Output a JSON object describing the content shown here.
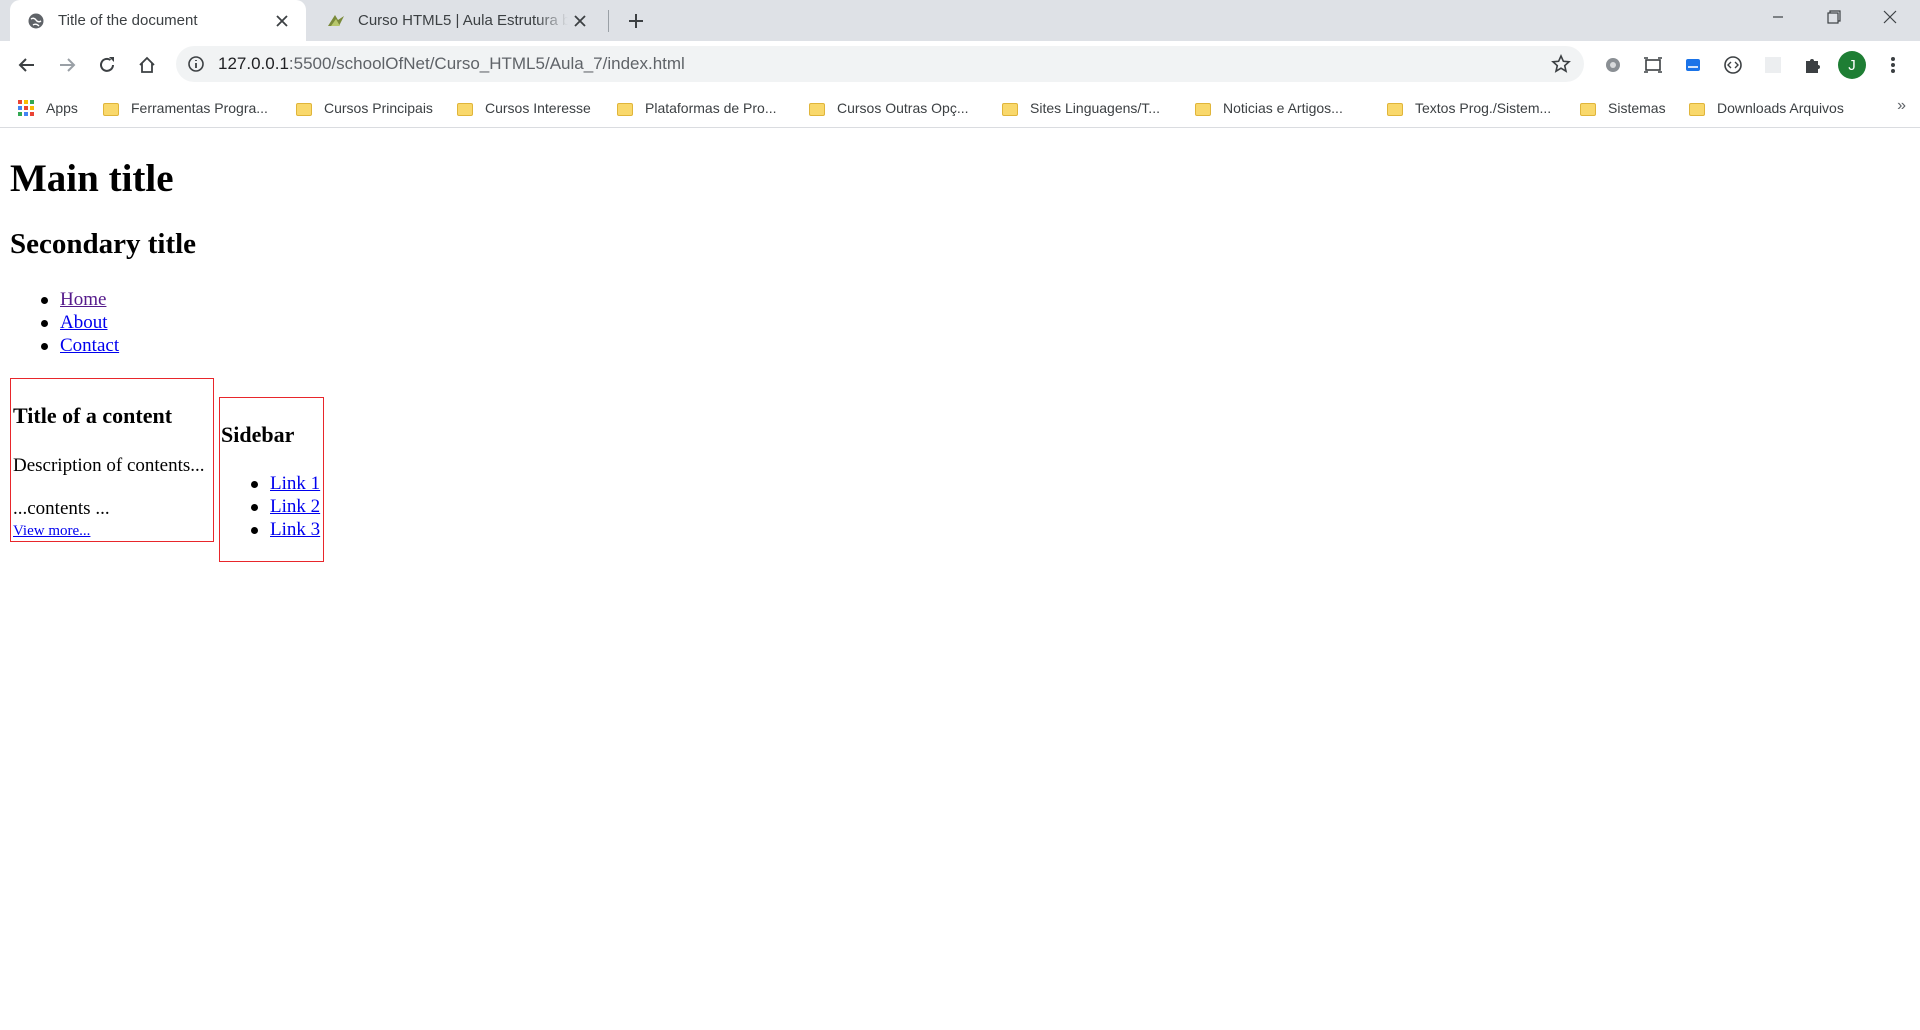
{
  "browser": {
    "tabs": [
      {
        "title": "Title of the document",
        "favicon": "globe-icon",
        "active": true
      },
      {
        "title": "Curso HTML5 | Aula Estrutura básica",
        "favicon": "schoolofnet-icon",
        "active": false
      }
    ],
    "new_tab_icon": "plus-icon",
    "window_controls": [
      "minimize-icon",
      "restore-icon",
      "close-icon"
    ],
    "address_bar": {
      "host": "127.0.0.1",
      "path": ":5500/schoolOfNet/Curso_HTML5/Aula_7/index.html"
    },
    "extensions": [
      "gear-extension-icon",
      "screenshot-extension-icon",
      "cloud-extension-icon",
      "code-extension-icon",
      "blank-extension-icon",
      "puzzle-icon"
    ],
    "profile_initial": "J",
    "bookmarks": [
      {
        "label": "Apps",
        "icon": "apps-grid-icon"
      },
      {
        "label": "Ferramentas Progra...",
        "icon": "folder-icon"
      },
      {
        "label": "Cursos Principais",
        "icon": "folder-icon"
      },
      {
        "label": "Cursos Interesse",
        "icon": "folder-icon"
      },
      {
        "label": "Plataformas de Pro...",
        "icon": "folder-icon"
      },
      {
        "label": "Cursos Outras Opç...",
        "icon": "folder-icon"
      },
      {
        "label": "Sites Linguagens/T...",
        "icon": "folder-icon"
      },
      {
        "label": "Noticias e Artigos...",
        "icon": "folder-icon"
      },
      {
        "label": "Textos Prog./Sistem...",
        "icon": "folder-icon"
      },
      {
        "label": "Sistemas",
        "icon": "folder-icon"
      },
      {
        "label": "Downloads Arquivos",
        "icon": "folder-icon"
      }
    ],
    "bookmarks_overflow": "»"
  },
  "page": {
    "main_title": "Main title",
    "secondary_title": "Secondary title",
    "nav": [
      "Home",
      "About",
      "Contact"
    ],
    "content": {
      "title": "Title of a content",
      "description": "Description of contents...",
      "body": "...contents ...",
      "link": "View more..."
    },
    "sidebar": {
      "title": "Sidebar",
      "links": [
        "Link 1",
        "Link 2",
        "Link 3"
      ]
    }
  },
  "colors": {
    "tabstrip": "#dee1e6",
    "box_border": "#e8262b",
    "link": "#0000ee",
    "visited_link": "#551a8b",
    "avatar": "#1e7e34"
  }
}
